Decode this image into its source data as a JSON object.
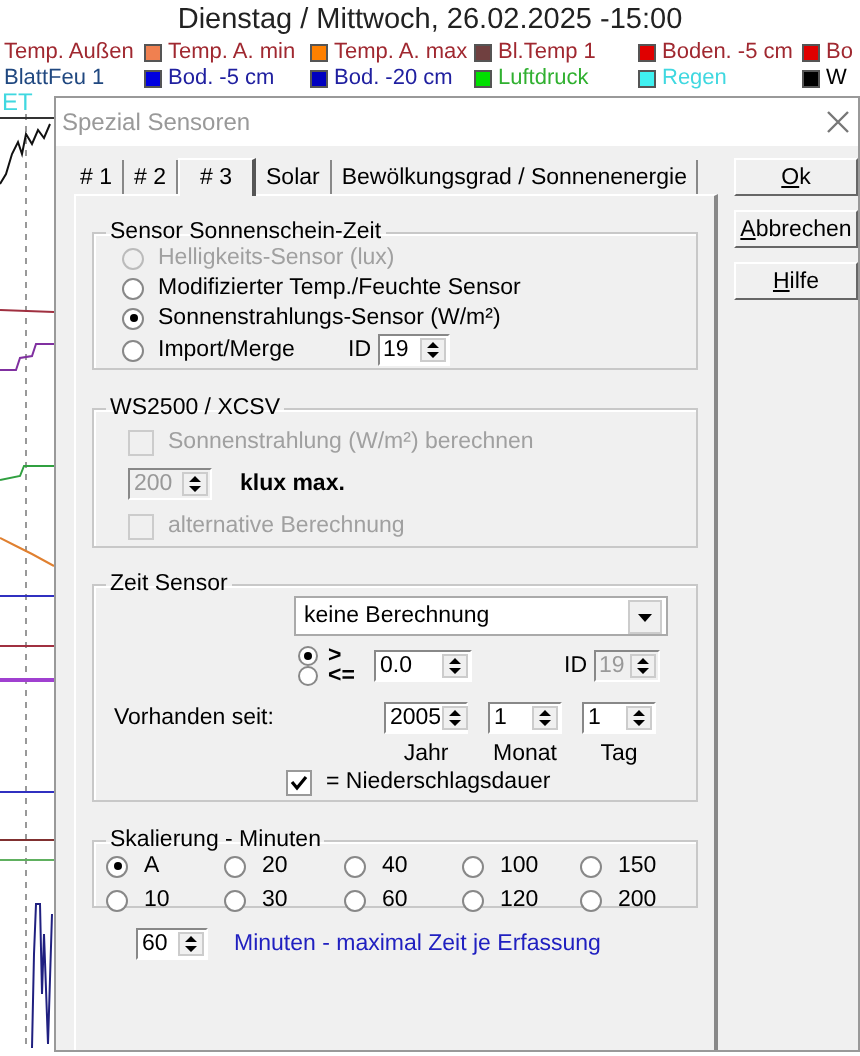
{
  "header": {
    "title": "Dienstag / Mittwoch, 26.02.2025  -15:00"
  },
  "legend_rows": [
    {
      "items": [
        {
          "label": "Temp. Außen",
          "color": "#a02830"
        },
        {
          "label": "Temp. A. min",
          "swatch": {
            "color": "#f08050"
          },
          "color": "#a02830"
        },
        {
          "label": "Temp. A. max",
          "swatch": {
            "color": "#ff8000"
          },
          "color": "#a02830"
        },
        {
          "label": "Bl.Temp 1",
          "swatch": {
            "color": "#704040"
          },
          "color": "#a02830"
        },
        {
          "label": "Boden. -5 cm",
          "swatch": {
            "color": "#e00000"
          },
          "color": "#a02830"
        },
        {
          "label": "Bo",
          "swatch": {
            "color": "#e00000"
          },
          "color": "#a02830"
        }
      ]
    },
    {
      "items": [
        {
          "label": "BlattFeu 1",
          "color": "#204880"
        },
        {
          "label": "Bod. -5 cm",
          "swatch": {
            "color": "#0000e0"
          },
          "color": "#2020a0"
        },
        {
          "label": "Bod. -20 cm",
          "swatch": {
            "color": "#0000c0"
          },
          "color": "#2020a0"
        },
        {
          "label": "Luftdruck",
          "swatch": {
            "color": "#00e000"
          },
          "color": "#30b030"
        },
        {
          "label": "Regen",
          "swatch": {
            "color": "#40f0f0"
          },
          "color": "#40d8e0"
        },
        {
          "label": "W",
          "swatch": {
            "color": "#000000"
          },
          "color": "#000000"
        }
      ]
    }
  ],
  "side_label": {
    "label": "ET",
    "color": "#40d8e0"
  },
  "dialog": {
    "title": "Spezial Sensoren",
    "tabs": [
      {
        "label": "# 1",
        "selected": false
      },
      {
        "label": "# 2",
        "selected": false
      },
      {
        "label": "# 3",
        "selected": true
      },
      {
        "label": "Solar",
        "selected": false
      },
      {
        "label": "Bewölkungsgrad / Sonnenenergie",
        "selected": false
      }
    ],
    "buttons": [
      {
        "key": "O",
        "rest": "k"
      },
      {
        "key": "A",
        "rest": "bbrechen"
      },
      {
        "key": "H",
        "rest": "ilfe"
      }
    ],
    "sunshine": {
      "title": "Sensor Sonnenschein-Zeit",
      "options": [
        {
          "label": "Helligkeits-Sensor (lux)",
          "selected": false,
          "disabled": true
        },
        {
          "label": "Modifizierter Temp./Feuchte Sensor",
          "selected": false,
          "disabled": false
        },
        {
          "label": "Sonnenstrahlungs-Sensor (W/m²)",
          "selected": true,
          "disabled": false
        },
        {
          "label": "Import/Merge",
          "selected": false,
          "disabled": false
        }
      ],
      "id": {
        "label": "ID",
        "value": "19",
        "disabled": false
      }
    },
    "ws2500": {
      "title": "WS2500 / XCSV",
      "calc": {
        "label": "Sonnenstrahlung (W/m²) berechnen",
        "checked": false,
        "disabled": true
      },
      "max": {
        "value": "200",
        "unit": "klux max.",
        "disabled": true
      },
      "alt": {
        "label": "alternative Berechnung",
        "checked": false,
        "disabled": true
      }
    },
    "time_sensor": {
      "title": "Zeit Sensor",
      "combo": "keine Berechnung",
      "compare": [
        {
          "label": ">",
          "selected": true
        },
        {
          "label": "<=",
          "selected": false
        }
      ],
      "threshold": "0.0",
      "id": {
        "label": "ID",
        "value": "19",
        "disabled": true
      },
      "since_label": "Vorhanden seit:",
      "date": [
        {
          "value": "2005",
          "label": "Jahr"
        },
        {
          "value": "1",
          "label": "Monat"
        },
        {
          "value": "1",
          "label": "Tag"
        }
      ],
      "rain": {
        "label": "= Niederschlagsdauer",
        "checked": true,
        "disabled": false
      }
    },
    "scaling": {
      "title": "Skalierung - Minuten",
      "options": [
        {
          "label": "A",
          "selected": true
        },
        {
          "label": "20",
          "selected": false
        },
        {
          "label": "40",
          "selected": false
        },
        {
          "label": "100",
          "selected": false
        },
        {
          "label": "150",
          "selected": false
        },
        {
          "label": "10",
          "selected": false
        },
        {
          "label": "30",
          "selected": false
        },
        {
          "label": "60",
          "selected": false
        },
        {
          "label": "120",
          "selected": false
        },
        {
          "label": "200",
          "selected": false
        }
      ]
    },
    "max_time": {
      "value": "60",
      "label": "Minuten -  maximal Zeit je Erfassung"
    }
  }
}
